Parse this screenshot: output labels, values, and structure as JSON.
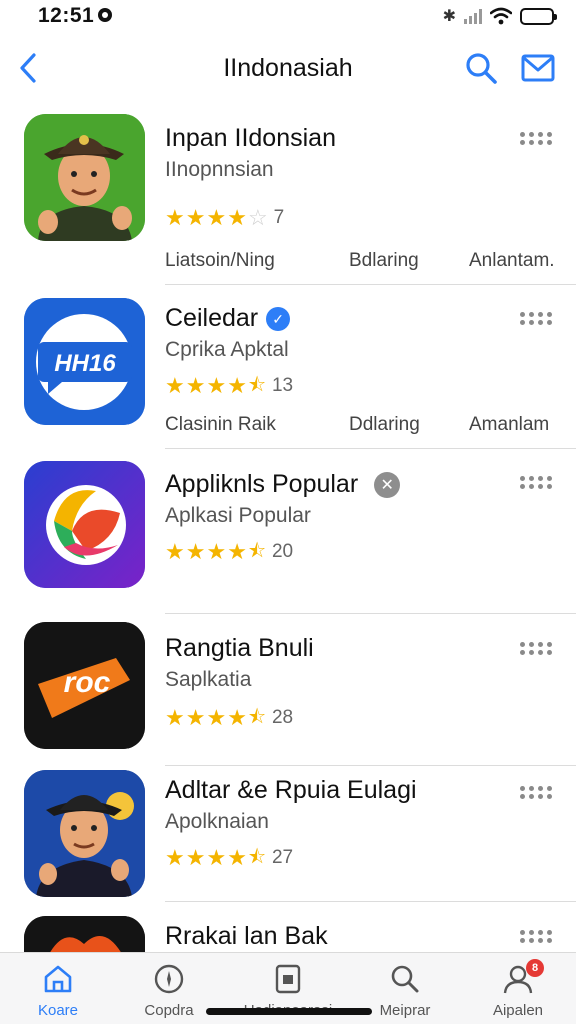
{
  "status_bar": {
    "time": "12:51"
  },
  "nav": {
    "title": "IIndonasiah"
  },
  "apps": [
    {
      "title": "Inpan IIdonsian",
      "subtitle": "IInopnnsian",
      "rating": 4,
      "rating_count": "7",
      "tags": [
        "Liatsoin/Ning",
        "Bdlaring",
        "Anlantam."
      ]
    },
    {
      "title": "Ceiledar",
      "subtitle": "Cprika  Apktal",
      "rating": 4.5,
      "rating_count": "13",
      "tags": [
        "Clasinin Raik",
        "Ddlaring",
        "Amanlam"
      ],
      "icon_text": "HH16"
    },
    {
      "title": "Appliknls Popular",
      "subtitle": "Aplkasi Popular",
      "rating": 4.5,
      "rating_count": "20"
    },
    {
      "title": "Rangtia Bnuli",
      "subtitle": "Saplkatia",
      "rating": 4.5,
      "rating_count": "28",
      "icon_text": "roc"
    },
    {
      "title": "Adltar &e Rpuia Eulagi",
      "subtitle": "Apolknaian",
      "rating": 4.5,
      "rating_count": "27"
    },
    {
      "title": "Rrakai lan Bak"
    }
  ],
  "tabs": [
    {
      "label": "Koare",
      "icon": "home-icon",
      "active": true
    },
    {
      "label": "Copdra",
      "icon": "compass-icon"
    },
    {
      "label": "Uadianoarasi",
      "icon": "apps-icon"
    },
    {
      "label": "Meiprar",
      "icon": "search-icon"
    },
    {
      "label": "Aipalen",
      "icon": "person-icon",
      "badge": "8"
    }
  ],
  "colors": {
    "accent": "#2d7ef7",
    "star": "#f4b400",
    "badge": "#e53935"
  }
}
